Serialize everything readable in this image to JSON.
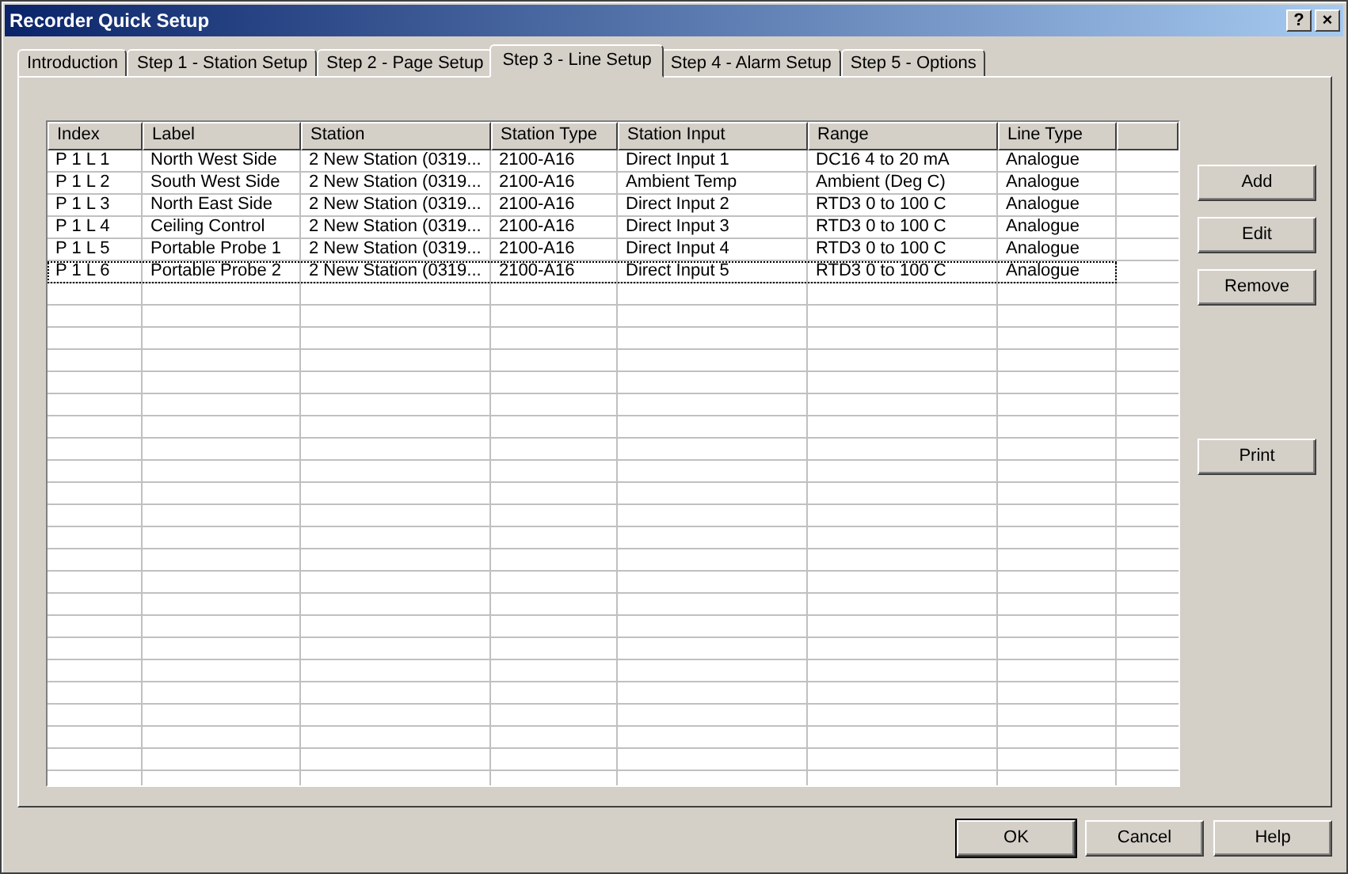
{
  "window": {
    "title": "Recorder Quick Setup",
    "help_button": "?",
    "close_button": "×"
  },
  "tabs": [
    {
      "label": "Introduction",
      "selected": false
    },
    {
      "label": "Step 1 - Station Setup",
      "selected": false
    },
    {
      "label": "Step 2 - Page Setup",
      "selected": false
    },
    {
      "label": "Step 3 - Line Setup",
      "selected": true
    },
    {
      "label": "Step 4 - Alarm Setup",
      "selected": false
    },
    {
      "label": "Step 5 - Options",
      "selected": false
    }
  ],
  "table": {
    "columns": [
      "Index",
      "Label",
      "Station",
      "Station Type",
      "Station Input",
      "Range",
      "Line Type"
    ],
    "rows": [
      {
        "cells": [
          "P 1 L 1",
          "North West Side",
          "2 New Station (0319...",
          "2100-A16",
          "Direct Input 1",
          "DC16 4 to 20 mA",
          "Analogue"
        ],
        "focused": false
      },
      {
        "cells": [
          "P 1 L 2",
          "South West Side",
          "2 New Station (0319...",
          "2100-A16",
          "Ambient Temp",
          "Ambient (Deg C)",
          "Analogue"
        ],
        "focused": false
      },
      {
        "cells": [
          "P 1 L 3",
          "North East Side",
          "2 New Station (0319...",
          "2100-A16",
          "Direct Input 2",
          "RTD3 0 to 100 C",
          "Analogue"
        ],
        "focused": false
      },
      {
        "cells": [
          "P 1 L 4",
          "Ceiling Control",
          "2 New Station (0319...",
          "2100-A16",
          "Direct Input 3",
          "RTD3 0 to 100 C",
          "Analogue"
        ],
        "focused": false
      },
      {
        "cells": [
          "P 1 L 5",
          "Portable Probe 1",
          "2 New Station (0319...",
          "2100-A16",
          "Direct Input 4",
          "RTD3 0 to 100 C",
          "Analogue"
        ],
        "focused": false
      },
      {
        "cells": [
          "P 1 L 6",
          "Portable Probe 2",
          "2 New Station (0319...",
          "2100-A16",
          "Direct Input 5",
          "RTD3 0 to 100 C",
          "Analogue"
        ],
        "focused": true
      }
    ]
  },
  "side_buttons": [
    "Add",
    "Edit",
    "Remove"
  ],
  "print_button": "Print",
  "footer_buttons": [
    {
      "label": "OK",
      "default": true
    },
    {
      "label": "Cancel",
      "default": false
    },
    {
      "label": "Help",
      "default": false
    }
  ]
}
